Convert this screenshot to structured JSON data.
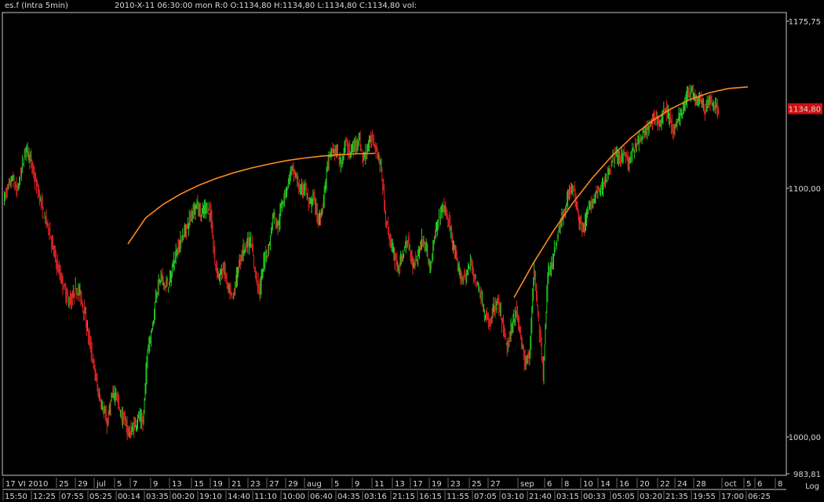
{
  "header": {
    "symbol": "es.f (Intra 5min)",
    "info": "2010-X-11    06:30:00 mon R:0 O:1134,80 H:1134,80 L:1134,80 C:1134,80 vol:"
  },
  "colors": {
    "up": "#22cc22",
    "down": "#dd2222",
    "fit": "#ff8a1e",
    "frame": "#c8c8c8",
    "badge": "#d01010"
  },
  "yaxis": {
    "labels": [
      "1175,75",
      "1100,00",
      "1000,00",
      "983,81"
    ],
    "log_label": "Log",
    "current": "1134,80"
  },
  "xaxis": {
    "top_labels": [
      "17 VI 2010",
      "25",
      "29",
      "jul",
      "5",
      "7",
      "9",
      "13",
      "15",
      "19",
      "21",
      "23",
      "27",
      "29",
      "aug",
      "5",
      "9",
      "11",
      "13",
      "17",
      "19",
      "23",
      "25",
      "27",
      "sep",
      "6",
      "8",
      "10",
      "14",
      "16",
      "20",
      "22",
      "24",
      "28",
      "oct",
      "5",
      "6",
      "8"
    ],
    "bottom_labels": [
      "15:50",
      "12:25",
      "07:55",
      "05:25",
      "00:14",
      "03:35",
      "00:20",
      "19:10",
      "14:40",
      "11:10",
      "10:00",
      "06:40",
      "04:35",
      "03:16",
      "21:15",
      "16:15",
      "11:55",
      "07:05",
      "03:10",
      "21:40",
      "03:15",
      "00:33",
      "05:05",
      "03:20",
      "21:35",
      "19:55",
      "17:00",
      "06:25"
    ]
  },
  "chart_data": {
    "type": "line",
    "title": "es.f (Intra 5min)",
    "xlabel": "",
    "ylabel": "",
    "log_scale": true,
    "ylim": [
      983.81,
      1175.75
    ],
    "series": [
      {
        "values": [
          1095,
          1100,
          1104,
          1098,
          1108,
          1118,
          1112,
          1103,
          1096,
          1088,
          1083,
          1074,
          1066,
          1060,
          1054,
          1051,
          1057,
          1055,
          1047,
          1036,
          1026,
          1015,
          1009,
          1002,
          1012,
          1015,
          1006,
          1003,
          998,
          1001,
          1005,
          1002,
          1032,
          1040,
          1056,
          1062,
          1058,
          1060,
          1070,
          1075,
          1080,
          1084,
          1090,
          1093,
          1088,
          1092,
          1089,
          1068,
          1062,
          1066,
          1056,
          1053,
          1064,
          1072,
          1076,
          1077,
          1063,
          1056,
          1070,
          1074,
          1089,
          1083,
          1094,
          1100,
          1108,
          1105,
          1098,
          1101,
          1092,
          1096,
          1085,
          1092,
          1110,
          1116,
          1116,
          1110,
          1120,
          1115,
          1118,
          1122,
          1112,
          1118,
          1122,
          1116,
          1108,
          1086,
          1077,
          1070,
          1066,
          1073,
          1077,
          1067,
          1070,
          1078,
          1074,
          1066,
          1080,
          1088,
          1092,
          1085,
          1075,
          1066,
          1061,
          1063,
          1068,
          1060,
          1056,
          1046,
          1042,
          1049,
          1051,
          1042,
          1032,
          1041,
          1048,
          1037,
          1026,
          1030,
          1066,
          1043,
          1022,
          1062,
          1068,
          1078,
          1085,
          1092,
          1100,
          1098,
          1086,
          1082,
          1090,
          1094,
          1098,
          1100,
          1104,
          1110,
          1115,
          1112,
          1116,
          1110,
          1116,
          1120,
          1122,
          1125,
          1128,
          1132,
          1128,
          1135,
          1132,
          1124,
          1130,
          1134,
          1140,
          1144,
          1138,
          1140,
          1133,
          1139,
          1136,
          1134
        ],
        "color": "#22cc22"
      },
      {
        "values": [
          1075.8,
          1086.9,
          1092.8,
          1097.3,
          1101.0,
          1104.0,
          1106.5,
          1108.6,
          1110.3,
          1111.8,
          1112.9,
          1113.8,
          1114.4,
          1114.8,
          1115.0
        ],
        "color": "#ff8a1e"
      },
      {
        "values": [
          1053.3,
          1067.8,
          1081.1,
          1093.2,
          1104.0,
          1113.6,
          1121.8,
          1128.8,
          1134.5,
          1138.8,
          1141.9,
          1143.9,
          1144.6
        ],
        "color": "#ff8a1e"
      }
    ]
  }
}
